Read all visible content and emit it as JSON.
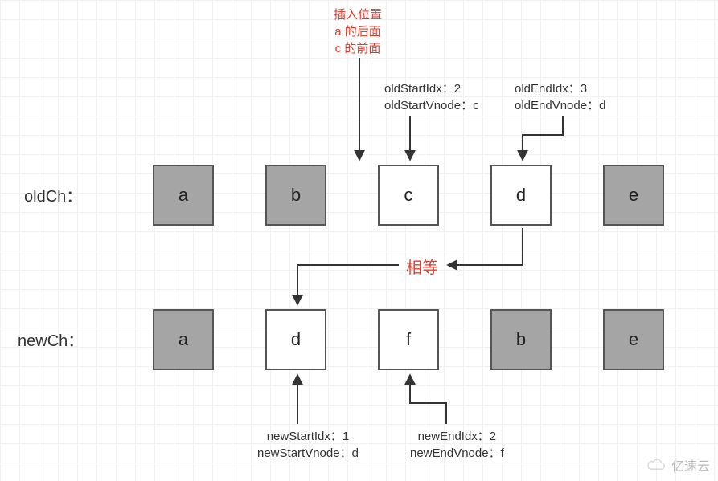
{
  "annotations": {
    "insert": {
      "l1": "插入位置",
      "l2": "a 的后面",
      "l3": "c 的前面"
    },
    "oldStart": {
      "l1": "oldStartIdx：2",
      "l2": "oldStartVnode：c"
    },
    "oldEnd": {
      "l1": "oldEndIdx：3",
      "l2": "oldEndVnode：d"
    },
    "newStart": {
      "l1": "newStartIdx：1",
      "l2": "newStartVnode：d"
    },
    "newEnd": {
      "l1": "newEndIdx：2",
      "l2": "newEndVnode：f"
    },
    "equal": "相等"
  },
  "rows": {
    "oldLabel": "oldCh：",
    "newLabel": "newCh：",
    "old": [
      "a",
      "b",
      "c",
      "d",
      "e"
    ],
    "new": [
      "a",
      "d",
      "f",
      "b",
      "e"
    ],
    "oldGrey": [
      true,
      true,
      false,
      false,
      true
    ],
    "newGrey": [
      true,
      false,
      false,
      true,
      true
    ]
  },
  "watermark": "亿速云"
}
